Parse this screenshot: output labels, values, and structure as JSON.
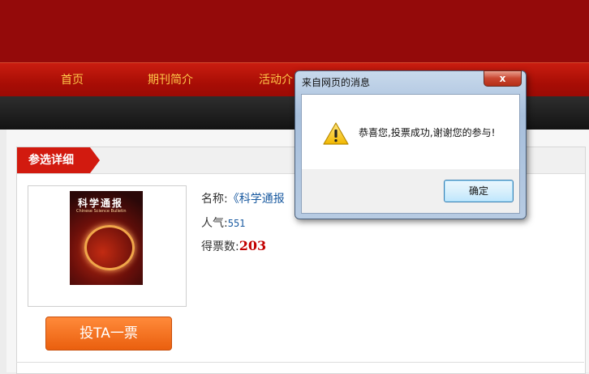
{
  "nav": {
    "items": [
      "首页",
      "期刊简介",
      "活动介"
    ]
  },
  "panel": {
    "tab_label": "参选详细"
  },
  "cover": {
    "title": "科学通报",
    "subtitle": "Chinese Science Bulletin"
  },
  "info": {
    "name_label": "名称:",
    "name_value": "《科学通报",
    "popularity_label": "人气:",
    "popularity_value": "551",
    "votes_label": "得票数:",
    "votes_value": "203"
  },
  "vote_button": "投TA一票",
  "dialog": {
    "title": "来自网页的消息",
    "close_label": "x",
    "message": "恭喜您,投票成功,谢谢您的参与!",
    "ok_label": "确定",
    "icon": "warning-icon"
  },
  "colors": {
    "brand_red": "#940a0a",
    "nav_text": "#ffc94a",
    "tab_red": "#d21a0f",
    "button_orange": "#ea5f0e",
    "votes_red": "#c20000"
  }
}
